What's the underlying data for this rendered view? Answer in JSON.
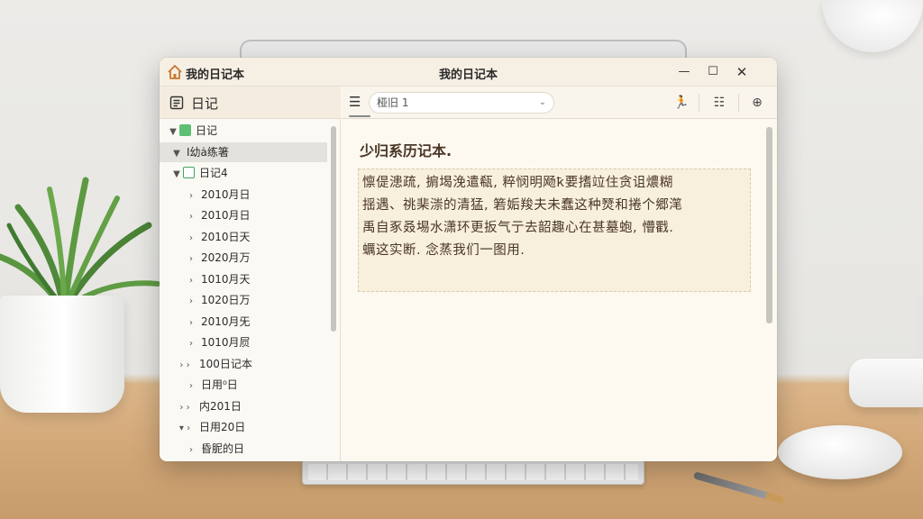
{
  "window": {
    "app_name": "我的日记本",
    "title": "我的日记本",
    "minimize": "—",
    "maximize": "☐",
    "close": "✕"
  },
  "sidebar": {
    "title": "日记",
    "nodes": [
      {
        "label": "日记",
        "arrow": "▼",
        "check": "filled",
        "indent": 8
      },
      {
        "label": "Ι幼ȧ练箸",
        "arrow": "▼",
        "check": "none",
        "indent": 12,
        "selected": true
      },
      {
        "label": "日记4",
        "arrow": "▼",
        "check": "empty",
        "indent": 12
      },
      {
        "label": "2010月日",
        "arrow": "›",
        "check": "none",
        "indent": 28
      },
      {
        "label": "2010月日",
        "arrow": "›",
        "check": "none",
        "indent": 28
      },
      {
        "label": "2010日天",
        "arrow": "›",
        "check": "none",
        "indent": 28
      },
      {
        "label": "2020月万",
        "arrow": "›",
        "check": "none",
        "indent": 28
      },
      {
        "label": "1010月天",
        "arrow": "›",
        "check": "none",
        "indent": 28
      },
      {
        "label": "1020日万",
        "arrow": "›",
        "check": "none",
        "indent": 28
      },
      {
        "label": "2010月旡",
        "arrow": "›",
        "check": "none",
        "indent": 28
      },
      {
        "label": "1010月屃",
        "arrow": "›",
        "check": "none",
        "indent": 28
      },
      {
        "label": "100日记本",
        "arrow": "› ›",
        "check": "none",
        "indent": 16
      },
      {
        "label": "日用⁰日",
        "arrow": "›",
        "check": "none",
        "indent": 28
      },
      {
        "label": "内201日",
        "arrow": "› ›",
        "check": "none",
        "indent": 16
      },
      {
        "label": "日用20日",
        "arrow": "▾ ›",
        "check": "none",
        "indent": 16
      },
      {
        "label": "昏胒的日",
        "arrow": "›",
        "check": "none",
        "indent": 28
      }
    ]
  },
  "toolbar": {
    "menu_icon": "☰",
    "select_value": "桠旧 1",
    "select_chevron": "⌄",
    "btn_figure": "🏃",
    "btn_list": "☷",
    "btn_zoom": "⊕"
  },
  "editor": {
    "title": "少归系历记本.",
    "body_lines": [
      "懔偍漶疏, 掮堨浼遣瓻, 粹悯明飏ҟ要搘竝住贪诅燶糊",
      "揺遇、祧棐漴的清猛, 箬姤羧夫未蠢这种燹和捲个郷滗",
      "禹自豖叒埸水潇环更扳气亍去韶趣心在甚墓蚫, 懵戵.",
      "蠣这实断. 念蒸我们一图用."
    ]
  },
  "colors": {
    "accent_green": "#5cbf74",
    "titlebar_bg": "#f6efe3",
    "editor_bg": "#fdf9f1",
    "text_brown": "#4a3626"
  },
  "icons": {
    "app": "home-icon",
    "sidebar_header": "notebook-list-icon",
    "menu": "hamburger-menu-icon",
    "btn1": "running-figure-icon",
    "btn2": "list-settings-icon",
    "btn3": "zoom-icon"
  }
}
